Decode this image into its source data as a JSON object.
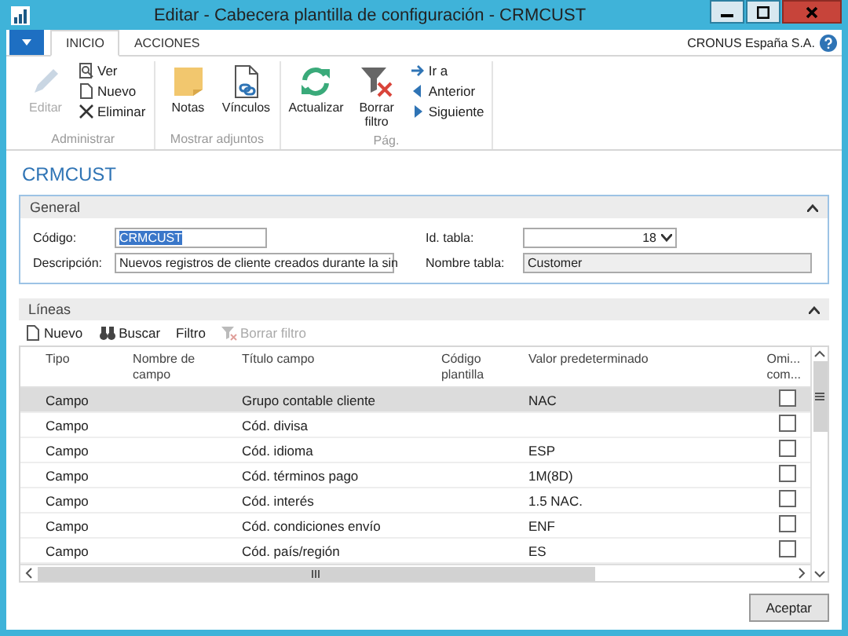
{
  "window": {
    "title": "Editar - Cabecera plantilla de configuración - CRMCUST"
  },
  "tabs": [
    {
      "label": "INICIO",
      "selected": true
    },
    {
      "label": "ACCIONES",
      "selected": false
    }
  ],
  "company": "CRONUS España S.A.",
  "ribbon": {
    "groups": [
      {
        "label": "Administrar",
        "items": [
          {
            "kind": "large",
            "label": "Editar",
            "disabled": true
          },
          {
            "kind": "small",
            "label": "Ver",
            "disabled": false
          },
          {
            "kind": "small",
            "label": "Nuevo",
            "disabled": false
          },
          {
            "kind": "small",
            "label": "Eliminar",
            "disabled": false
          }
        ]
      },
      {
        "label": "Mostrar adjuntos",
        "items": [
          {
            "kind": "large",
            "label": "Notas",
            "disabled": false
          },
          {
            "kind": "large",
            "label": "Vínculos",
            "disabled": false
          }
        ]
      },
      {
        "label": "Pág.",
        "items": [
          {
            "kind": "large",
            "label": "Actualizar",
            "disabled": false
          },
          {
            "kind": "large",
            "label": "Borrar filtro",
            "disabled": false
          },
          {
            "kind": "small",
            "label": "Ir a",
            "disabled": false
          },
          {
            "kind": "small",
            "label": "Anterior",
            "disabled": false
          },
          {
            "kind": "small",
            "label": "Siguiente",
            "disabled": false
          }
        ]
      }
    ]
  },
  "page_title": "CRMCUST",
  "general": {
    "title": "General",
    "expanded": true,
    "fields": [
      {
        "label": "Código:",
        "value": "CRMCUST",
        "kind": "text"
      },
      {
        "label": "Id. tabla:",
        "value": "18",
        "kind": "dropdown"
      },
      {
        "label": "Descripción:",
        "value": "Nuevos registros de cliente creados durante la sin",
        "kind": "text"
      },
      {
        "label": "Nombre tabla:",
        "value": "Customer",
        "kind": "readonly"
      }
    ]
  },
  "lines": {
    "title": "Líneas",
    "expanded": true,
    "toolbar": [
      {
        "label": "Nuevo",
        "disabled": false
      },
      {
        "label": "Buscar",
        "disabled": false
      },
      {
        "label": "Filtro",
        "disabled": false
      },
      {
        "label": "Borrar filtro",
        "disabled": true
      }
    ],
    "columns": [
      [
        "Tipo"
      ],
      [
        "Nombre de",
        "campo"
      ],
      [
        "Título campo"
      ],
      [
        "Código",
        "plantilla"
      ],
      [
        "Valor predeterminado"
      ],
      [
        "Omi...",
        "com..."
      ]
    ],
    "rows": [
      {
        "tipo": "Campo",
        "titulo": "Grupo contable cliente",
        "valor": "NAC",
        "checked": false,
        "selected": true
      },
      {
        "tipo": "Campo",
        "titulo": "Cód. divisa",
        "checked": false,
        "selected": false
      },
      {
        "tipo": "Campo",
        "titulo": "Cód. idioma",
        "valor": "ESP",
        "checked": false,
        "selected": false
      },
      {
        "tipo": "Campo",
        "titulo": "Cód. términos pago",
        "valor": "1M(8D)",
        "checked": false,
        "selected": false
      },
      {
        "tipo": "Campo",
        "titulo": "Cód. interés",
        "valor": "1.5 NAC.",
        "checked": false,
        "selected": false
      },
      {
        "tipo": "Campo",
        "titulo": "Cód. condiciones envío",
        "valor": "ENF",
        "checked": false,
        "selected": false
      },
      {
        "tipo": "Campo",
        "titulo": "Cód. país/región",
        "valor": "ES",
        "checked": false,
        "selected": false
      }
    ]
  },
  "buttons": [
    "Aceptar"
  ]
}
